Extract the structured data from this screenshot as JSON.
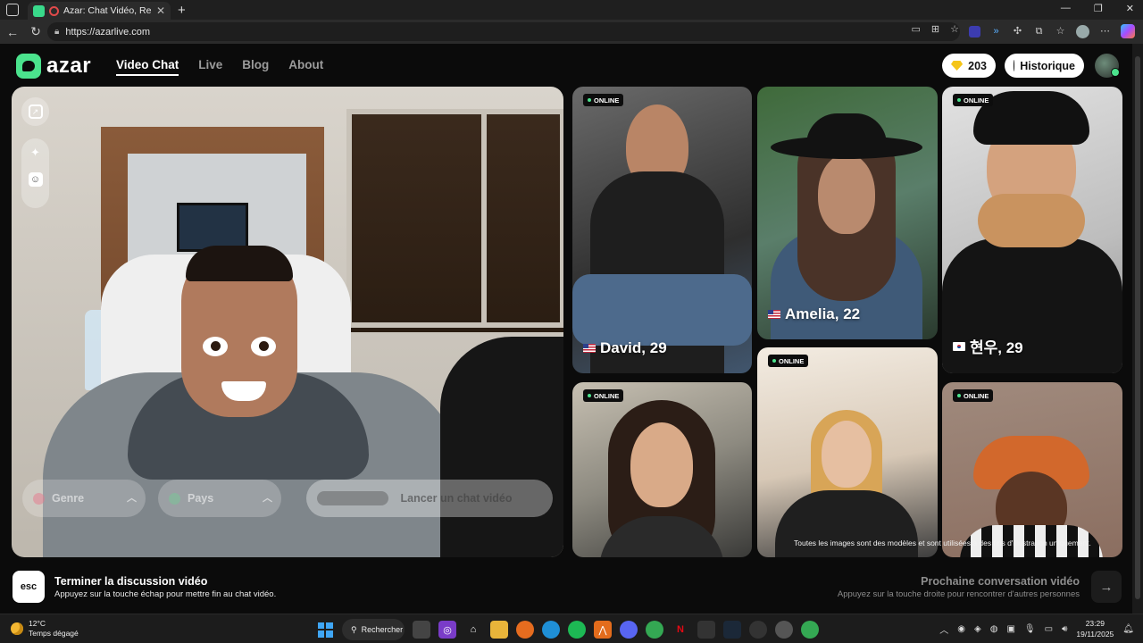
{
  "browser": {
    "tab_title": "Azar: Chat Vidéo, Rencontre",
    "url": "https://azarlive.com"
  },
  "header": {
    "logo_text": "azar",
    "nav": [
      {
        "label": "Video Chat",
        "active": true
      },
      {
        "label": "Live",
        "active": false
      },
      {
        "label": "Blog",
        "active": false
      },
      {
        "label": "About",
        "active": false
      }
    ],
    "gems_count": "203",
    "history_label": "Historique"
  },
  "video_panel": {
    "filters": {
      "genre_label": "Genre",
      "pays_label": "Pays",
      "launch_label": "Lancer un chat vidéo"
    }
  },
  "profiles": [
    {
      "name": "David, 29",
      "flag": "us",
      "online": "ONLINE"
    },
    {
      "name": "Amelia, 22",
      "flag": "us",
      "online": ""
    },
    {
      "name": "현우, 29",
      "flag": "kr",
      "online": "ONLINE"
    },
    {
      "name": "",
      "flag": "",
      "online": "ONLINE"
    },
    {
      "name": "",
      "flag": "",
      "online": "ONLINE"
    },
    {
      "name": "",
      "flag": "",
      "online": "ONLINE"
    }
  ],
  "disclaimer": "Toutes les images sont des modèles et sont utilisées à des fins d'illustration uniquement.",
  "bottom_bar": {
    "esc_key": "esc",
    "end_title": "Terminer la discussion vidéo",
    "end_sub": "Appuyez sur la touche échap pour mettre fin au chat vidéo.",
    "next_title": "Prochaine conversation vidéo",
    "next_sub": "Appuyez sur la touche droite pour rencontrer d'autres personnes"
  },
  "taskbar": {
    "temperature": "12°C",
    "weather": "Temps dégagé",
    "search_label": "Rechercher",
    "time": "23:29",
    "date": "19/11/2025"
  },
  "colors": {
    "accent_green": "#4be38d",
    "gem": "#f5c518"
  }
}
